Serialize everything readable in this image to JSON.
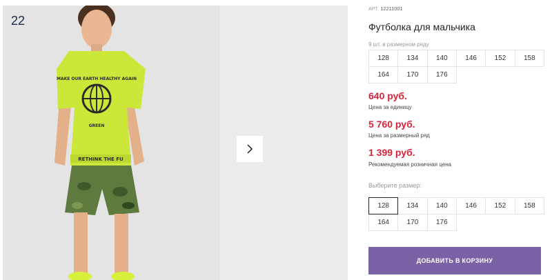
{
  "gallery": {
    "slide_number": "22",
    "shirt_print_lines": [
      "MAKE OUR EARTH HEALTHY AGAIN",
      "GREEN",
      "RETHINK THE FU"
    ]
  },
  "product": {
    "art_label": "АРТ.",
    "art_value": "12211001",
    "title": "Футболка для мальчика",
    "count_note": "9 шт. в размерном ряду",
    "size_row_sizes": [
      "128",
      "134",
      "140",
      "146",
      "152",
      "158",
      "164",
      "170",
      "176"
    ]
  },
  "prices": {
    "unit_price": "640 руб.",
    "unit_note": "Цена за единицу",
    "row_price": "5 760 руб.",
    "row_note": "Цена за размерный ряд",
    "retail_price": "1 399 руб.",
    "retail_note": "Рекомендуемая розничная цена"
  },
  "size_select": {
    "label": "Выберите размер:",
    "options": [
      "128",
      "134",
      "140",
      "146",
      "152",
      "158",
      "164",
      "170",
      "176"
    ],
    "selected": "128"
  },
  "cart": {
    "add_label": "ДОБАВИТЬ В КОРЗИНУ"
  },
  "colors": {
    "price_red": "#d8243b",
    "button_purple": "#7b62a6",
    "shirt_lime": "#cbe83a"
  },
  "icons": {
    "next": "chevron-right-icon"
  }
}
